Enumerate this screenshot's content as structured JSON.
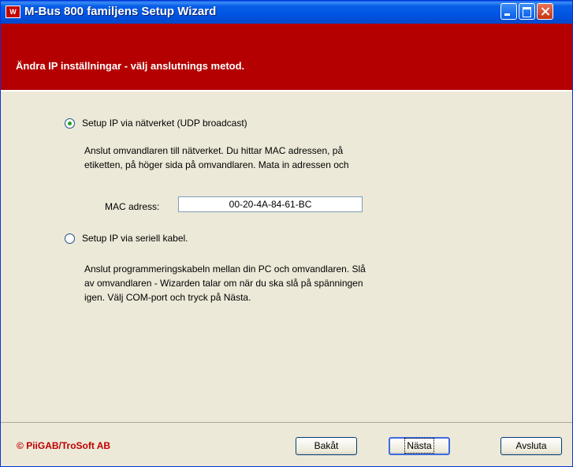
{
  "window": {
    "title": "M-Bus 800 familjens Setup Wizard",
    "icon_letter": "W"
  },
  "header": {
    "title": "Ändra IP inställningar - välj anslutnings metod."
  },
  "options": {
    "network": {
      "label": "Setup IP via nätverket (UDP broadcast)",
      "selected": true,
      "desc_line1": "Anslut omvandlaren till nätverket. Du hittar MAC adressen, på",
      "desc_line2": "etiketten, på höger sida på omvandlaren. Mata in adressen och"
    },
    "mac": {
      "label": "MAC adress:",
      "value": "00-20-4A-84-61-BC"
    },
    "serial": {
      "label": "Setup IP via seriell kabel.",
      "selected": false,
      "desc_line1": "Anslut programmeringskabeln mellan din PC och omvandlaren. Slå",
      "desc_line2": "av omvandlaren - Wizarden talar om när du ska slå på spänningen",
      "desc_line3": "igen. Välj COM-port och tryck på Nästa."
    }
  },
  "footer": {
    "copyright_symbol": "©",
    "brand": "PiiGAB/TroSoft AB",
    "back_label": "Bakåt",
    "next_label": "Nästa",
    "exit_label": "Avsluta"
  },
  "colors": {
    "header_band": "#b40000",
    "titlebar": "#0054e3",
    "brand": "#c00000"
  }
}
